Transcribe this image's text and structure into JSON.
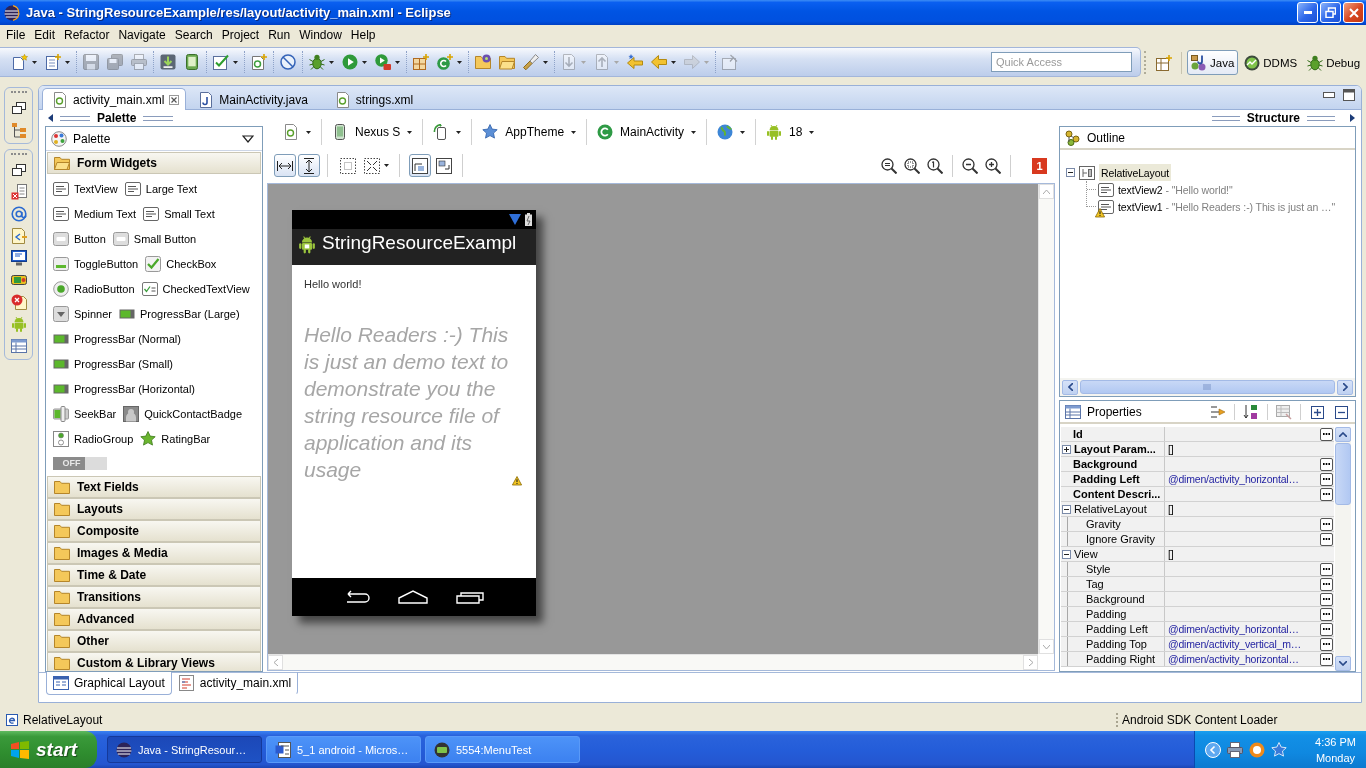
{
  "window": {
    "title": "Java - StringResourceExample/res/layout/activity_main.xml - Eclipse"
  },
  "menu": [
    "File",
    "Edit",
    "Refactor",
    "Navigate",
    "Search",
    "Project",
    "Run",
    "Window",
    "Help"
  ],
  "toolbar": [
    [
      {
        "kind": "new",
        "menu": true,
        "disabled": false
      },
      {
        "kind": "newfile",
        "menu": true,
        "disabled": false
      }
    ],
    [
      {
        "kind": "save",
        "menu": false,
        "disabled": true
      },
      {
        "kind": "saveall",
        "menu": false,
        "disabled": true
      },
      {
        "kind": "print",
        "menu": false,
        "disabled": true
      }
    ],
    [
      {
        "kind": "sdk",
        "menu": false,
        "disabled": false
      },
      {
        "kind": "avd",
        "menu": false,
        "disabled": false
      }
    ],
    [
      {
        "kind": "lint",
        "menu": true,
        "disabled": false
      }
    ],
    [
      {
        "kind": "newxml",
        "menu": false,
        "disabled": false
      }
    ],
    [
      {
        "kind": "skip",
        "menu": false,
        "disabled": false
      }
    ],
    [
      {
        "kind": "debug",
        "menu": true,
        "disabled": false
      },
      {
        "kind": "run",
        "menu": true,
        "disabled": false
      },
      {
        "kind": "external",
        "menu": true,
        "disabled": false
      }
    ],
    [
      {
        "kind": "newpackage",
        "menu": false,
        "disabled": false
      },
      {
        "kind": "newclass",
        "menu": true,
        "disabled": false
      }
    ],
    [
      {
        "kind": "opentype",
        "menu": false,
        "disabled": false
      },
      {
        "kind": "openfolder",
        "menu": false,
        "disabled": false
      },
      {
        "kind": "search",
        "menu": true,
        "disabled": false
      }
    ],
    [
      {
        "kind": "nextannotation",
        "menu": true,
        "disabled": true
      },
      {
        "kind": "prevannotation",
        "menu": true,
        "disabled": true
      },
      {
        "kind": "lastedit",
        "menu": false,
        "disabled": false
      },
      {
        "kind": "back",
        "menu": true,
        "disabled": false
      },
      {
        "kind": "forward",
        "menu": true,
        "disabled": true
      }
    ],
    [
      {
        "kind": "pin",
        "menu": false,
        "disabled": true
      }
    ]
  ],
  "quick_access": {
    "placeholder": "Quick Access"
  },
  "perspectives": [
    {
      "label": "Java",
      "kind": "java",
      "selected": true
    },
    {
      "label": "DDMS",
      "kind": "ddms",
      "selected": false
    },
    {
      "label": "Debug",
      "kind": "debug",
      "selected": false
    }
  ],
  "editor_tabs": [
    {
      "label": "activity_main.xml",
      "kind": "layout",
      "selected": true
    },
    {
      "label": "MainActivity.java",
      "kind": "java",
      "selected": false
    },
    {
      "label": "strings.xml",
      "kind": "layout",
      "selected": false
    }
  ],
  "palette": {
    "title": "Palette",
    "chooser": "Palette",
    "groups": [
      {
        "label": "Form Widgets",
        "expanded": true,
        "rows": [
          [
            {
              "label": "TextView",
              "kind": "text"
            },
            {
              "label": "Large Text",
              "kind": "text"
            }
          ],
          [
            {
              "label": "Medium Text",
              "kind": "text"
            },
            {
              "label": "Small Text",
              "kind": "text"
            }
          ],
          [
            {
              "label": "Button",
              "kind": "button"
            },
            {
              "label": "Small Button",
              "kind": "button"
            }
          ],
          [
            {
              "label": "ToggleButton",
              "kind": "toggle"
            },
            {
              "label": "CheckBox",
              "kind": "checkbox"
            }
          ],
          [
            {
              "label": "RadioButton",
              "kind": "radio"
            },
            {
              "label": "CheckedTextView",
              "kind": "checkedtext"
            }
          ],
          [
            {
              "label": "Spinner",
              "kind": "spinner"
            },
            {
              "label": "ProgressBar (Large)",
              "kind": "progress"
            }
          ],
          [
            {
              "label": "ProgressBar (Normal)",
              "kind": "progress"
            }
          ],
          [
            {
              "label": "ProgressBar (Small)",
              "kind": "progress"
            }
          ],
          [
            {
              "label": "ProgressBar (Horizontal)",
              "kind": "progress"
            }
          ],
          [
            {
              "label": "SeekBar",
              "kind": "seekbar"
            },
            {
              "label": "QuickContactBadge",
              "kind": "badge"
            }
          ],
          [
            {
              "label": "RadioGroup",
              "kind": "radiogroup"
            },
            {
              "label": "RatingBar",
              "kind": "rating"
            }
          ],
          [
            {
              "label": "OFF",
              "kind": "switch",
              "on": false
            }
          ]
        ]
      },
      {
        "label": "Text Fields",
        "expanded": false
      },
      {
        "label": "Layouts",
        "expanded": false
      },
      {
        "label": "Composite",
        "expanded": false
      },
      {
        "label": "Images & Media",
        "expanded": false
      },
      {
        "label": "Time & Date",
        "expanded": false
      },
      {
        "label": "Transitions",
        "expanded": false
      },
      {
        "label": "Advanced",
        "expanded": false
      },
      {
        "label": "Other",
        "expanded": false
      },
      {
        "label": "Custom & Library Views",
        "expanded": false
      }
    ]
  },
  "config_bar": [
    {
      "kind": "layout"
    },
    {
      "kind": "device",
      "label": "Nexus S"
    },
    {
      "kind": "orientation"
    },
    {
      "kind": "theme",
      "label": "AppTheme"
    },
    {
      "kind": "activity",
      "label": "MainActivity"
    },
    {
      "kind": "locale"
    },
    {
      "kind": "api",
      "label": "18"
    }
  ],
  "layout_actions": [
    [
      {
        "kind": "fillwidth",
        "on": true,
        "menu": false
      },
      {
        "kind": "fillheight",
        "on": true,
        "menu": false
      }
    ],
    [
      {
        "kind": "margins",
        "on": false,
        "menu": false
      },
      {
        "kind": "resize",
        "on": false,
        "menu": true
      }
    ],
    [
      {
        "kind": "anchor",
        "on": true,
        "menu": false
      },
      {
        "kind": "corner",
        "on": false,
        "menu": false
      }
    ]
  ],
  "error_count": "1",
  "device": {
    "app_title": "StringResourceExampl",
    "views": [
      {
        "kind": "small",
        "text": "Hello world!",
        "warning": false
      },
      {
        "kind": "large",
        "text": "Hello Readers :-) This is just an demo text to demonstrate you the string resource file of application and its usage",
        "warning": true
      }
    ]
  },
  "layout_tabs": [
    {
      "label": "Graphical Layout",
      "kind": "graphical",
      "selected": true
    },
    {
      "label": "activity_main.xml",
      "kind": "xml",
      "selected": false
    }
  ],
  "structure": {
    "title": "Structure"
  },
  "outline": {
    "title": "Outline",
    "tree": [
      {
        "name": "RelativeLayout",
        "kind": "layout",
        "selected": true,
        "expanded": true,
        "warning": false,
        "children": [
          {
            "name": "textView2",
            "detail": "- \"Hello world!\"",
            "kind": "text",
            "selected": false,
            "warning": false
          },
          {
            "name": "textView1",
            "detail": "- \"Hello Readers :-) This is just an …\"",
            "kind": "text",
            "selected": false,
            "warning": true
          }
        ]
      }
    ]
  },
  "properties": {
    "title": "Properties",
    "rows": [
      {
        "name": "Id",
        "kind": "main",
        "editor_button": true
      },
      {
        "name": "Layout Param...",
        "kind": "main",
        "expanded": false,
        "value": "[]",
        "editor_button": false
      },
      {
        "name": "Background",
        "kind": "main",
        "editor_button": true
      },
      {
        "name": "Padding Left",
        "kind": "main",
        "value": "@dimen/activity_horizontal…",
        "editor_button": true
      },
      {
        "name": "Content Descri...",
        "kind": "main",
        "editor_button": true
      },
      {
        "name": "RelativeLayout",
        "kind": "group",
        "expanded": true,
        "value": "[]",
        "editor_button": false
      },
      {
        "name": "Gravity",
        "kind": "sub",
        "editor_button": true
      },
      {
        "name": "Ignore Gravity",
        "kind": "sub",
        "editor_button": true
      },
      {
        "name": "View",
        "kind": "group",
        "expanded": true,
        "value": "[]",
        "editor_button": false
      },
      {
        "name": "Style",
        "kind": "sub",
        "editor_button": true
      },
      {
        "name": "Tag",
        "kind": "sub",
        "editor_button": true
      },
      {
        "name": "Background",
        "kind": "sub",
        "editor_button": true
      },
      {
        "name": "Padding",
        "kind": "sub",
        "editor_button": true
      },
      {
        "name": "Padding Left",
        "kind": "sub",
        "value": "@dimen/activity_horizontal…",
        "editor_button": true
      },
      {
        "name": "Padding Top",
        "kind": "sub",
        "value": "@dimen/activity_vertical_m…",
        "editor_button": true
      },
      {
        "name": "Padding Right",
        "kind": "sub",
        "value": "@dimen/activity_horizontal…",
        "editor_button": true
      }
    ]
  },
  "status_bar": {
    "selection": "RelativeLayout",
    "job": "Android SDK Content Loader"
  },
  "taskbar": {
    "start": "start",
    "tasks": [
      {
        "label": "Java - StringResour…",
        "kind": "eclipse",
        "selected": true
      },
      {
        "label": "5_1 android - Micros…",
        "kind": "document",
        "selected": false
      },
      {
        "label": "5554:MenuTest",
        "kind": "emulator",
        "selected": false
      }
    ],
    "time": "4:36 PM",
    "day": "Monday"
  }
}
